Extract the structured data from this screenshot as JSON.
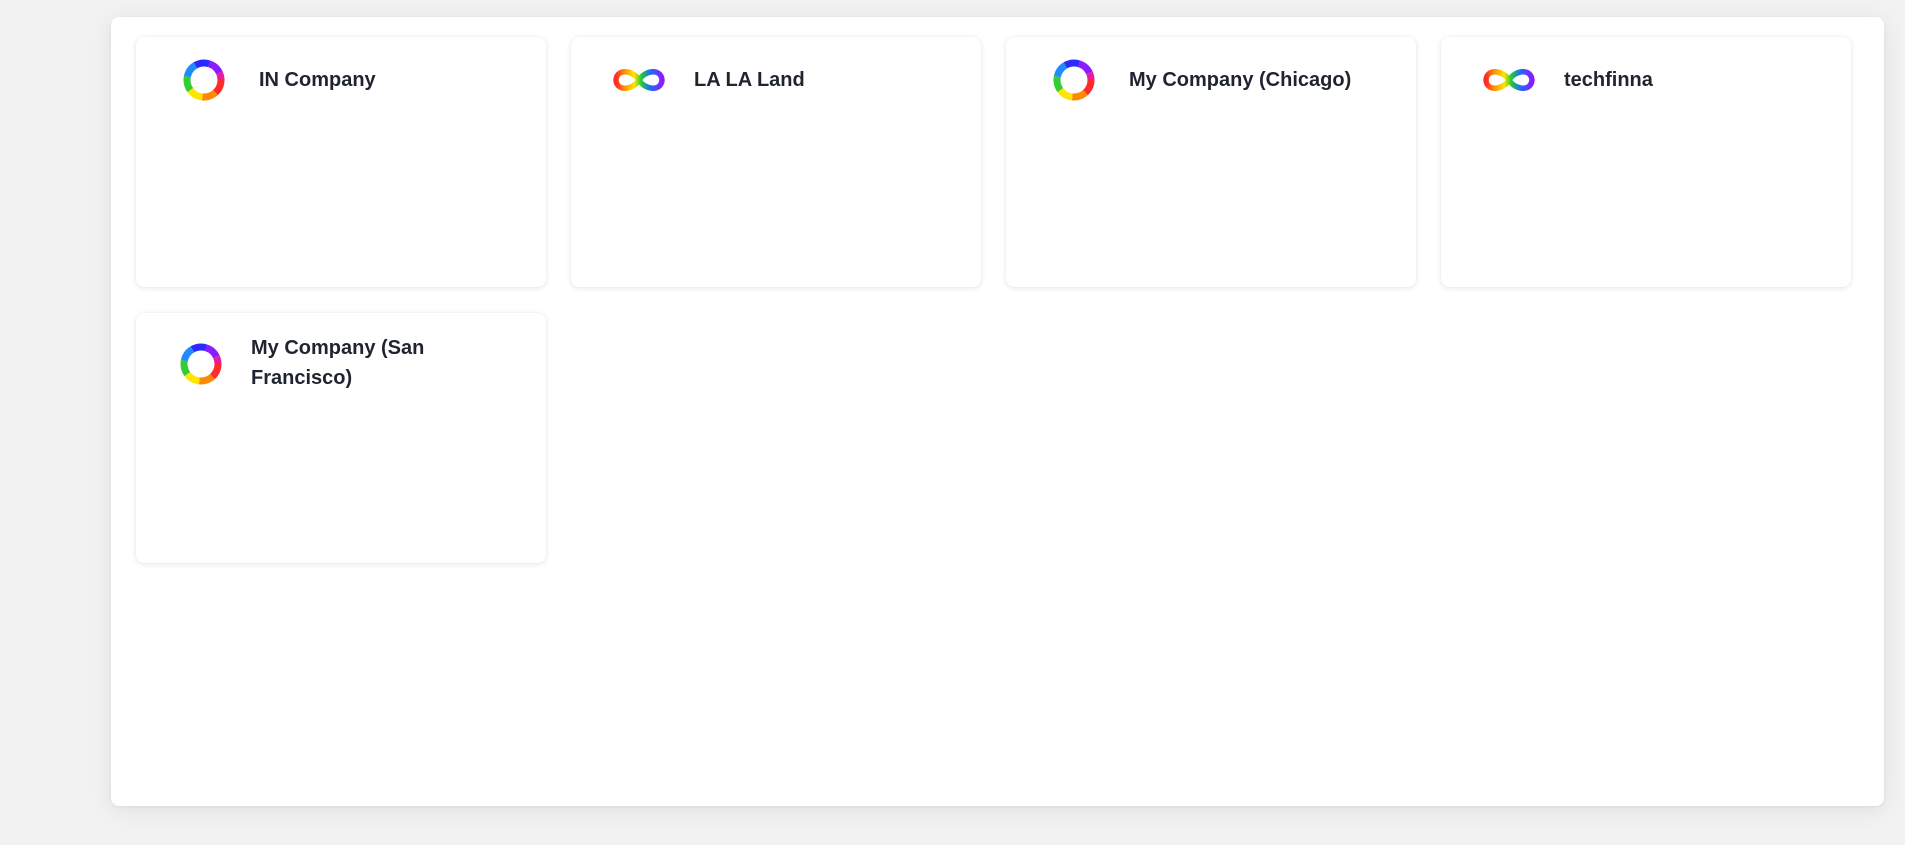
{
  "companies": [
    {
      "name": "IN Company",
      "logo": "rainbow-ring-icon"
    },
    {
      "name": "LA LA Land",
      "logo": "rainbow-infinity-icon"
    },
    {
      "name": "My Company (Chicago)",
      "logo": "rainbow-ring-icon"
    },
    {
      "name": "techfinna",
      "logo": "rainbow-infinity-icon"
    },
    {
      "name": "My Company (San Francisco)",
      "logo": "rainbow-ring-icon"
    }
  ]
}
